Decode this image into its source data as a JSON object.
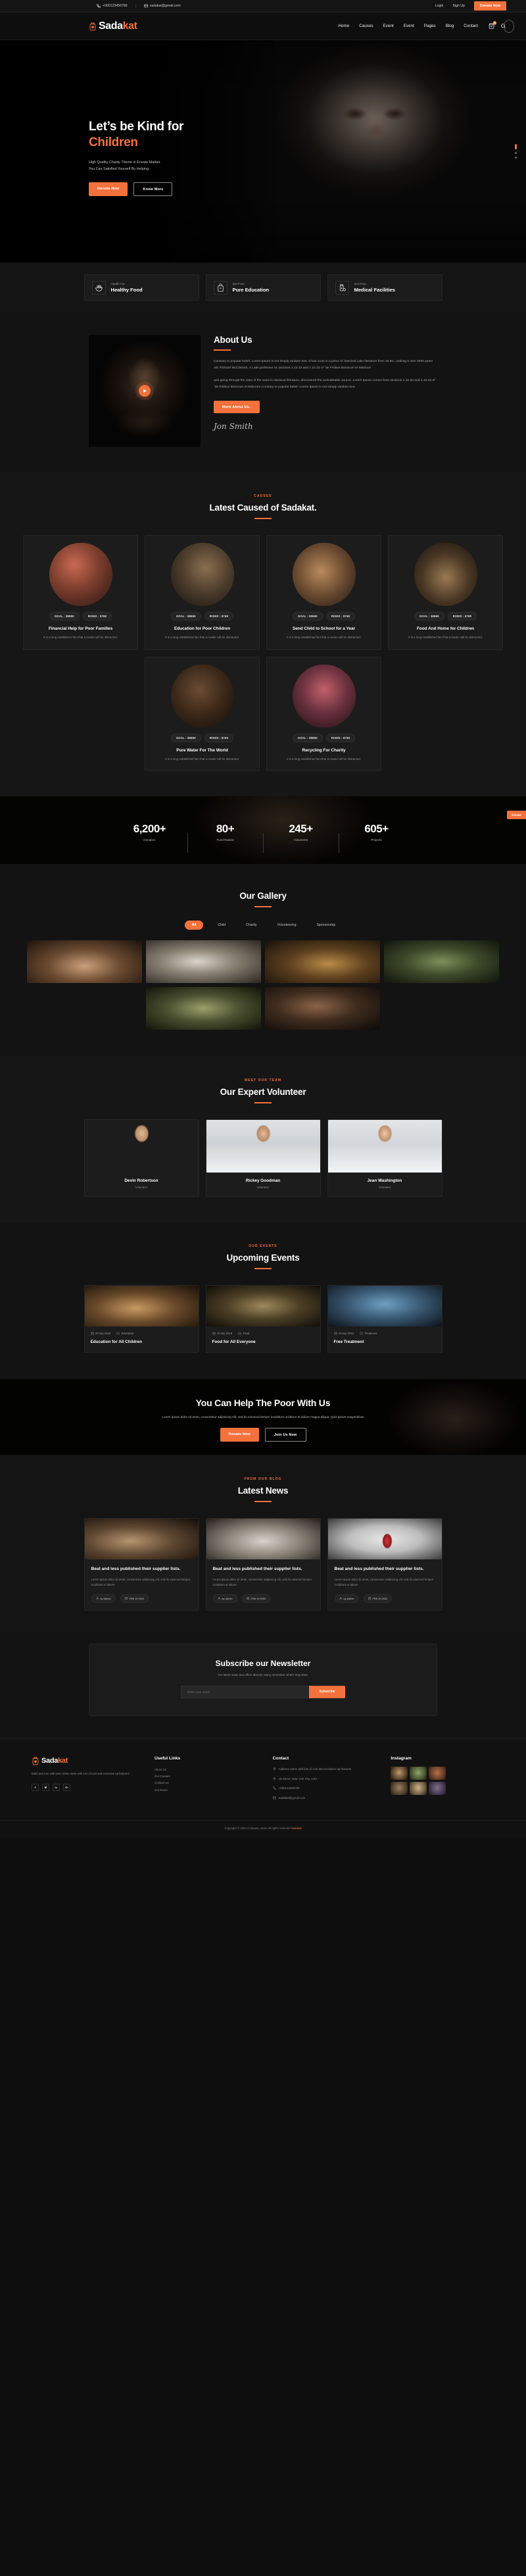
{
  "topbar": {
    "phone": "+000123456789",
    "email": "sadakat@gmail.com",
    "login": "Login",
    "signup": "Sign Up",
    "donate": "Donate Now"
  },
  "header": {
    "logo_main": "Sada",
    "logo_alt": "kat",
    "nav": [
      {
        "label": "Home"
      },
      {
        "label": "Causes"
      },
      {
        "label": "Event"
      },
      {
        "label": "Event"
      },
      {
        "label": "Pages"
      },
      {
        "label": "Blog"
      },
      {
        "label": "Contact"
      }
    ],
    "cart_count": "02"
  },
  "hero": {
    "title_line1": "Let’s be Kind for",
    "title_line2": "Children",
    "para1": "High Quality Charity Theme in Envato Market.",
    "para2": "You Can Satisfied Yourself By Helping.",
    "btn_primary": "Donate Now",
    "btn_secondary": "Know More"
  },
  "features": [
    {
      "sub": "Health For",
      "title": "Healthy Food",
      "icon": "salad-bowl-icon"
    },
    {
      "sub": "Get Free",
      "title": "Pure Education",
      "icon": "backpack-icon"
    },
    {
      "sub": "Get Free",
      "title": "Medical Facilities",
      "icon": "medicine-bottle-icon"
    }
  ],
  "about": {
    "heading": "About Us",
    "para1": "Contrary to popular belief, Lorem Ipsum is not simply random text. It has roots in a piece of classical Latin literature from 45 BC, making it over 2000 years old. Richard McClintock, a Latin professor at ,sections 1.10.32 and 1.10.33 of \"de Finibus Bonorum et Malorum",
    "para2": "and going through the cites of the word in classical literature, discovered the undoubtable source. Lorem Ipsum comes from sections 1.10.32 and 1.10.33 of \"de Finibus Bonorum et Malorum,Contrary to popular belief, Lorem Ipsum is not simply random text.",
    "button": "More About Us..",
    "signature": "Jon Smith"
  },
  "causes": {
    "eyebrow": "CAUSES",
    "heading": "Latest Caused of Sadakat.",
    "goal_label": "GOAL : $9860",
    "rised_label": "RISED : $768",
    "desc": "It is a long established fact that a reader will be distracted.",
    "items": [
      {
        "title": "Financial Help for Poor Families"
      },
      {
        "title": "Education for Poor Children"
      },
      {
        "title": "Send Child to School for a Year"
      },
      {
        "title": "Food And Home for Children"
      },
      {
        "title": "Pure Water For The World"
      },
      {
        "title": "Recycling For Charity"
      }
    ]
  },
  "counters": {
    "tab_label": "Donate",
    "items": [
      {
        "num": "6,200+",
        "label": "Donation"
      },
      {
        "num": "80+",
        "label": "Fund Raised"
      },
      {
        "num": "245+",
        "label": "Volunteers"
      },
      {
        "num": "605+",
        "label": "Projects"
      }
    ]
  },
  "gallery": {
    "heading": "Our Gallery",
    "filters": [
      "All",
      "Child",
      "Charity",
      "Volunteering",
      "Sponsorship"
    ],
    "active_filter": "All"
  },
  "team": {
    "eyebrow": "Meet Our Team",
    "heading": "Our Expert Volunteer",
    "members": [
      {
        "name": "Devin Robertson",
        "role": "Volunteer"
      },
      {
        "name": "Rickey Goodman",
        "role": "Volunteer"
      },
      {
        "name": "Jean Washington",
        "role": "Volunteer"
      }
    ]
  },
  "events": {
    "eyebrow": "Our Events",
    "heading": "Upcoming Events",
    "items": [
      {
        "date": "20 sep 2018",
        "category": "Education",
        "title": "Education for All Children"
      },
      {
        "date": "20 sep 2018",
        "category": "Food",
        "title": "Food for All Everyone"
      },
      {
        "date": "20 sep 2018",
        "category": "Treatment",
        "title": "Free Treatment"
      }
    ]
  },
  "cta": {
    "heading": "You Can Help The Poor With Us",
    "para": "Lorem ipsum dolor sit amet, consectetur adipiscing elit, sed do eiusmod tempor incididunt ut labore et dolore magna aliqua. Quis ipsum suspendisse",
    "btn_primary": "Donate Now",
    "btn_secondary": "Join Us Now"
  },
  "blog": {
    "eyebrow": "From Our Blog",
    "heading": "Latest News",
    "posts": [
      {
        "title": "Beat and less published their supplier lists.",
        "excerpt": "Lorem ipsum dolor sit amet, consectetur adipiscing elit, sed do eiusmod tempor incididunt ut labore",
        "author": "by Admin",
        "comments": "FEB 15 2022"
      },
      {
        "title": "Beat and less published their supplier lists.",
        "excerpt": "Lorem ipsum dolor sit amet, consectetur adipiscing elit, sed do eiusmod tempor incididunt ut labore",
        "author": "by Admin",
        "comments": "FEB 15 2022"
      },
      {
        "title": "Beat and less published their supplier lists.",
        "excerpt": "Lorem ipsum dolor sit amet, consectetur adipiscing elit, sed do eiusmod tempor incididunt ut labore",
        "author": "by Admin",
        "comments": "FEB 15 2022"
      }
    ]
  },
  "newsletter": {
    "heading": "Subscribe our Newsletter",
    "sub": "Get latest news and offers directly. Many remember what's important.",
    "placeholder": "Enter your email",
    "button": "Subscribe"
  },
  "footer": {
    "logo_main": "Sada",
    "logo_alt": "kat",
    "about": "Build and turn with your online store with lots of cool and exclusive up features",
    "socials": [
      "facebook-icon",
      "twitter-icon",
      "linkedin-icon",
      "google-plus-icon"
    ],
    "useful_title": "Useful Links",
    "useful_links": [
      "About Us",
      "Our Causes",
      "Contact Us",
      "Our Event"
    ],
    "contact_title": "Contact",
    "contact_items": [
      {
        "icon": "location-icon",
        "text": "Address name with lots of cool and exclusive up features"
      },
      {
        "icon": "location-icon",
        "text": "48 Street, New York City, USA"
      },
      {
        "icon": "phone-icon",
        "text": "+000123456789"
      },
      {
        "icon": "mail-icon",
        "text": "Sadakat@gmail.com"
      }
    ],
    "instagram_title": "Instagram",
    "copyright_pre": "Copyright © 2022 Company name all rights reserved",
    "copyright_brand": "Sadakat"
  }
}
